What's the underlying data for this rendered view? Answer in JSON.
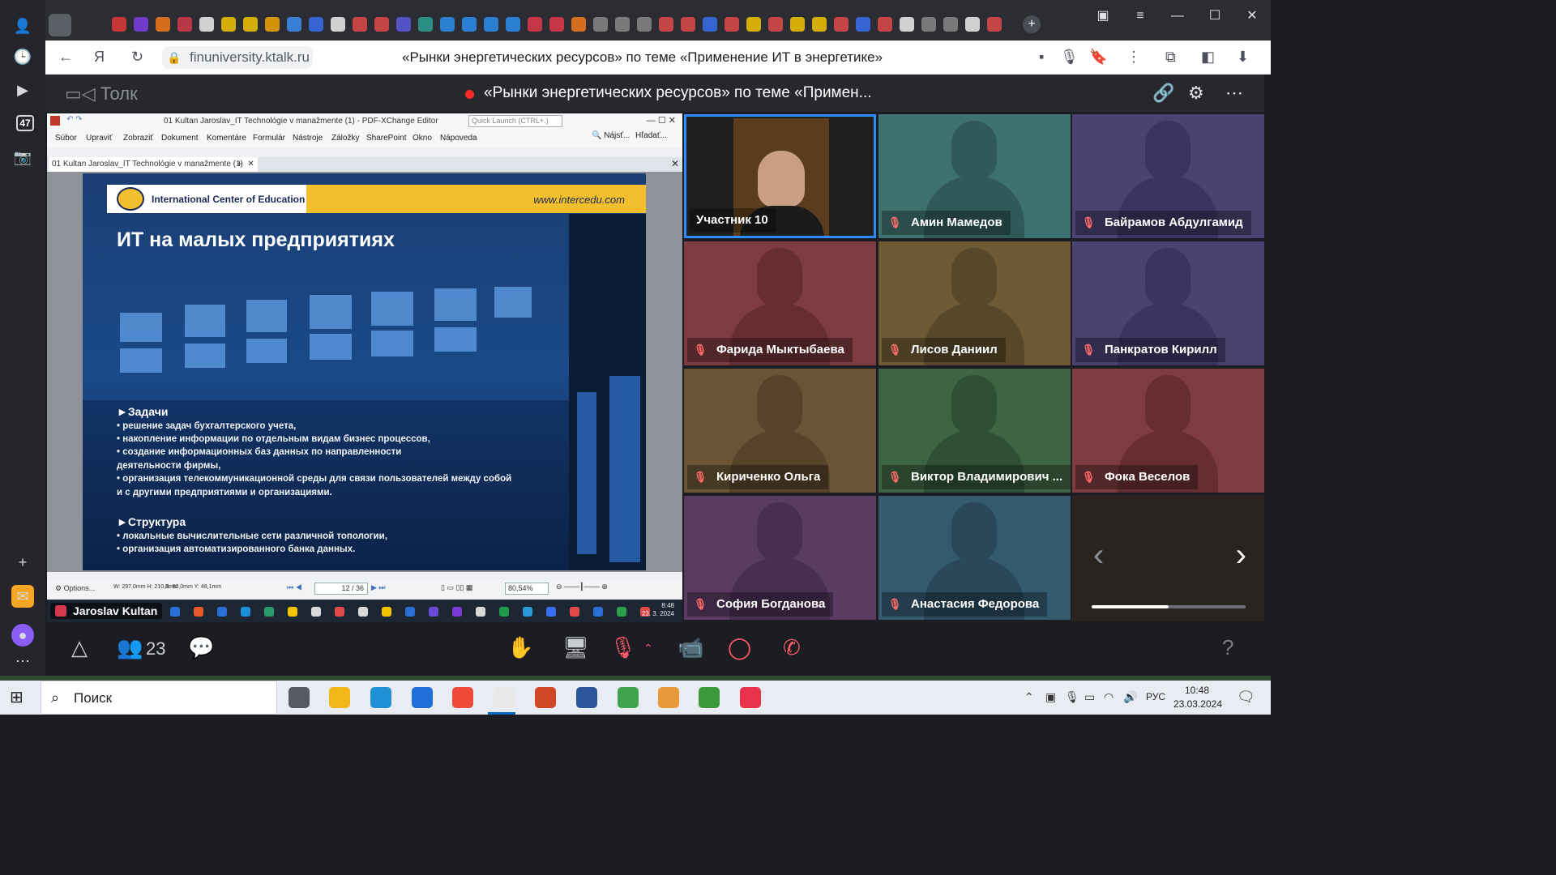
{
  "browser": {
    "url": "finuniversity.ktalk.ru",
    "page_title": "«Рынки энергетических ресурсов» по теме «Применение ИТ в энергетике»"
  },
  "sidebar": {
    "badge": "47"
  },
  "meeting": {
    "app_name": "Толк",
    "title": "«Рынки энергетических ресурсов» по теме «Примен...",
    "participant_count": "23"
  },
  "shared_screen": {
    "presenter": "Jaroslav Kultan",
    "editor": {
      "window_title": "01 Kultan Jaroslav_IT Technológie v manažmente (1) - PDF-XChange Editor",
      "quick_launch_placeholder": "Quick Launch (CTRL+.)",
      "menu": [
        "Súbor",
        "Upraviť",
        "Zobraziť",
        "Dokument",
        "Komentáre",
        "Formulár",
        "Nástroje",
        "Záložky",
        "SharePoint",
        "Okno",
        "Nápoveda"
      ],
      "find_label": "Nájsť...",
      "search_label": "Hľadať...",
      "doc_tab": "01 Kultan Jaroslav_IT Technológie v manažmente (1)",
      "options_label": "Options...",
      "page_size": "W: 297,0mm  H: 210,0mm",
      "cursor_pos": "X: 82,0mm  Y: 48,1mm",
      "page_indicator": "12 / 36",
      "zoom": "80,54%",
      "taskbar_time": "8:48",
      "taskbar_date": "23. 3. 2024"
    },
    "slide": {
      "org": "International Center of Education",
      "url": "www.intercedu.com",
      "heading": "ИТ на малых предприятиях",
      "section1_title": "►Задачи",
      "section1_items": [
        "• решение задач бухгалтерского учета,",
        "• накопление информации по отдельным видам бизнес процессов,",
        "• создание информационных баз данных по направленности деятельности фирмы,",
        "• организация телекоммуникационной среды для связи пользователей между собой и с другими предприятиями и организациями."
      ],
      "section2_title": "►Структура",
      "section2_items": [
        "• локальные вычислительные сети различной топологии,",
        "• организация автоматизированного банка данных."
      ]
    }
  },
  "participants": [
    {
      "name": "Участник 10",
      "muted": false,
      "video": true
    },
    {
      "name": "Амин Мамедов",
      "muted": true,
      "color": "#3e7270",
      "head": "#30595a"
    },
    {
      "name": "Байрамов Абдулгамид",
      "muted": true,
      "color": "#4a4270",
      "head": "#3a3460"
    },
    {
      "name": "Фарида Мыктыбаева",
      "muted": true,
      "color": "#7d3c3f",
      "head": "#662e31"
    },
    {
      "name": "Лисов Даниил",
      "muted": true,
      "color": "#6d5a35",
      "head": "#584829"
    },
    {
      "name": "Панкратов Кирилл",
      "muted": true,
      "color": "#4a4270",
      "head": "#3a3460"
    },
    {
      "name": "Кириченко Ольга",
      "muted": true,
      "color": "#6a5435",
      "head": "#564329"
    },
    {
      "name": "Виктор Владимирович ...",
      "muted": true,
      "color": "#3e6543",
      "head": "#305035"
    },
    {
      "name": "Фока Веселов",
      "muted": true,
      "color": "#7d3c3f",
      "head": "#662e31"
    },
    {
      "name": "София Богданова",
      "muted": true,
      "color": "#5a3c63",
      "head": "#482f50"
    },
    {
      "name": "Анастасия Федорова",
      "muted": true,
      "color": "#345a70",
      "head": "#29485a"
    }
  ],
  "grid_pager": {
    "page_fraction": 0.5
  },
  "taskbar": {
    "search_placeholder": "Поиск",
    "language": "РУС",
    "time": "10:48",
    "date": "23.03.2024"
  },
  "colors": {
    "accent": "#2d8cff",
    "record": "#ff2a2a",
    "muted_icon": "#ff6b6b"
  }
}
